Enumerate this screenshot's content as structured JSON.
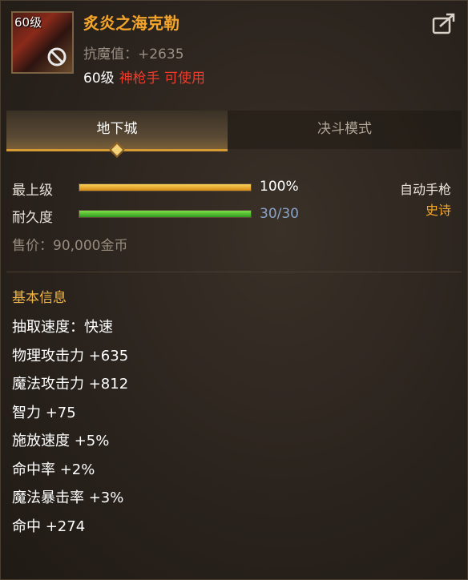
{
  "item": {
    "level_badge": "60级",
    "name": "炙炎之海克勒",
    "resist": "抗魔值：+2635",
    "req_level": "60级",
    "req_class": "神枪手 可使用"
  },
  "tabs": [
    {
      "label": "地下城",
      "active": true
    },
    {
      "label": "决斗模式",
      "active": false
    }
  ],
  "stats": {
    "upgrade_label": "最上级",
    "upgrade_value": "100%",
    "upgrade_fraction": 1.0,
    "durability_label": "耐久度",
    "durability_value": "30/30",
    "durability_fraction": 1.0,
    "weapon_type": "自动手枪",
    "rarity": "史诗"
  },
  "price": "售价：90,000金币",
  "basic": {
    "title": "基本信息",
    "attributes": [
      "抽取速度：快速",
      "物理攻击力 +635",
      "魔法攻击力 +812",
      "智力 +75",
      "施放速度 +5%",
      "命中率 +2%",
      "魔法暴击率 +3%",
      "命中 +274"
    ]
  },
  "colors": {
    "name": "#f2a52a",
    "class_req": "#f03a2a",
    "rarity": "#f2a52a",
    "durability_text": "#8aa2c8",
    "upgrade_bar": "#e8a625",
    "durability_bar": "#4cc02e"
  },
  "icons": [
    "no-entry-icon",
    "share-icon",
    "tab-diamond-icon"
  ]
}
